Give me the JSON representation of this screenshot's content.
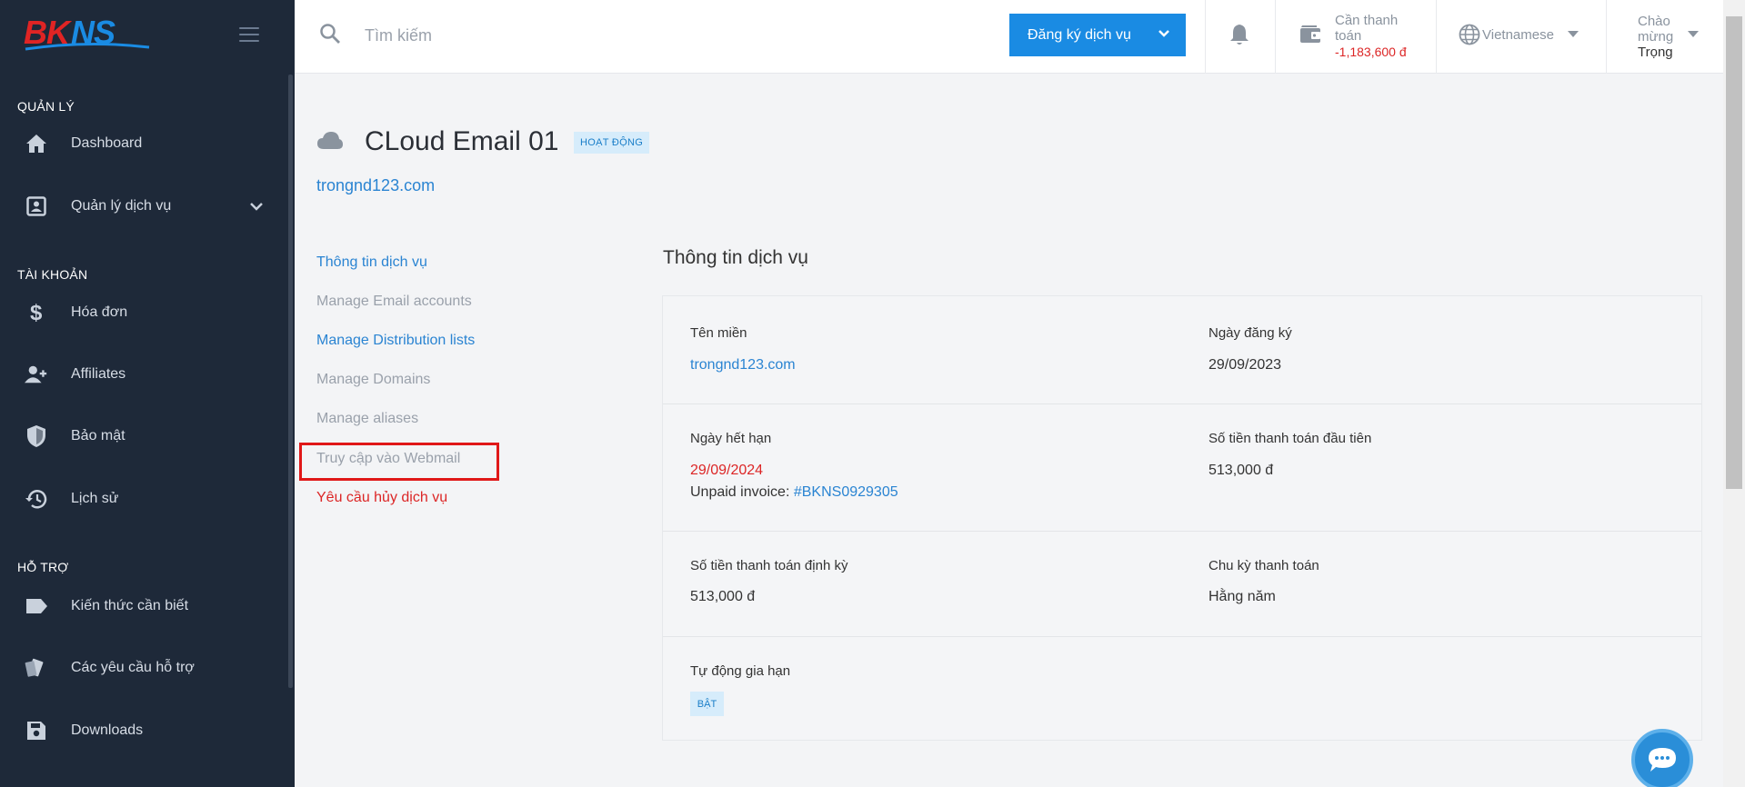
{
  "brand": {
    "logo_text": "BKNS",
    "colors": {
      "logo_red": "#e02424",
      "logo_blue": "#1a8be3",
      "sidebar_bg": "#1e2939",
      "accent": "#1a8be3",
      "danger": "#dc2626"
    }
  },
  "sidebar": {
    "sections": [
      {
        "title": "QUẢN LÝ",
        "items": [
          {
            "label": "Dashboard",
            "icon": "home-icon"
          },
          {
            "label": "Quản lý dịch vụ",
            "icon": "account-box-icon",
            "expandable": true
          }
        ]
      },
      {
        "title": "TÀI KHOẢN",
        "items": [
          {
            "label": "Hóa đơn",
            "icon": "dollar-icon"
          },
          {
            "label": "Affiliates",
            "icon": "user-plus-icon"
          },
          {
            "label": "Bảo mật",
            "icon": "shield-icon"
          },
          {
            "label": "Lịch sử",
            "icon": "history-icon"
          }
        ]
      },
      {
        "title": "HỖ TRỢ",
        "items": [
          {
            "label": "Kiến thức cần biết",
            "icon": "label-icon"
          },
          {
            "label": "Các yêu cầu hỗ trợ",
            "icon": "ticket-icon"
          },
          {
            "label": "Downloads",
            "icon": "save-icon"
          }
        ]
      }
    ]
  },
  "topbar": {
    "search_placeholder": "Tìm kiếm",
    "register_label": "Đăng ký dịch vụ",
    "wallet_label": "Cần thanh toán",
    "wallet_amount": "-1,183,600 đ",
    "language": "Vietnamese",
    "greeting": "Chào mừng",
    "user_name": "Trọng"
  },
  "service": {
    "title": "CLoud Email 01",
    "status": "HOẠT ĐỘNG",
    "domain": "trongnd123.com"
  },
  "subnav": [
    {
      "label": "Thông tin dịch vụ",
      "style": "blue"
    },
    {
      "label": "Manage Email accounts",
      "style": "gray"
    },
    {
      "label": "Manage Distribution lists",
      "style": "blue"
    },
    {
      "label": "Manage Domains",
      "style": "gray"
    },
    {
      "label": "Manage aliases",
      "style": "gray"
    },
    {
      "label": "Truy cập vào Webmail",
      "style": "gray",
      "highlighted": true
    },
    {
      "label": "Yêu cầu hủy dịch vụ",
      "style": "red"
    }
  ],
  "info": {
    "heading": "Thông tin dịch vụ",
    "domain_label": "Tên miền",
    "domain_value": "trongnd123.com",
    "reg_date_label": "Ngày đăng ký",
    "reg_date_value": "29/09/2023",
    "expiry_label": "Ngày hết hạn",
    "expiry_value": "29/09/2024",
    "unpaid_label": "Unpaid invoice:",
    "unpaid_invoice": "#BKNS0929305",
    "first_payment_label": "Số tiền thanh toán đầu tiên",
    "first_payment_value": "513,000 đ",
    "recurring_label": "Số tiền thanh toán định kỳ",
    "recurring_value": "513,000 đ",
    "cycle_label": "Chu kỳ thanh toán",
    "cycle_value": "Hằng năm",
    "auto_renew_label": "Tự động gia hạn",
    "auto_renew_value": "BẬT"
  }
}
